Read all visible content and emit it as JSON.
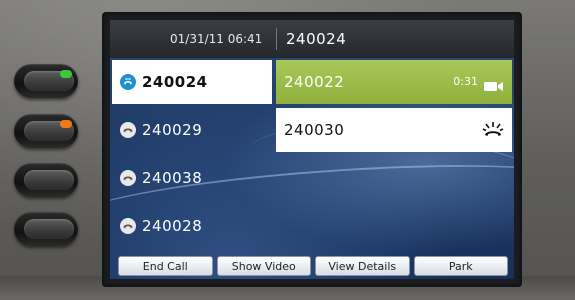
{
  "header": {
    "datetime": "01/31/11 06:41",
    "line_number": "240024"
  },
  "lines": [
    {
      "label": "240024",
      "state": "active",
      "icon": "phone-handset-active-icon"
    },
    {
      "label": "240029",
      "state": "idle",
      "icon": "phone-handset-icon"
    },
    {
      "label": "240038",
      "state": "idle",
      "icon": "phone-handset-icon"
    },
    {
      "label": "240028",
      "state": "idle",
      "icon": "phone-handset-icon"
    }
  ],
  "calls": [
    {
      "number": "240022",
      "duration": "0:31",
      "icon": "video-camera-icon",
      "color": "#9bbd4a"
    },
    {
      "number": "240030",
      "icon": "ringing-icon"
    }
  ],
  "softkeys": [
    "End Call",
    "Show Video",
    "View Details",
    "Park"
  ],
  "led_colors": {
    "line1": "#3cc83c",
    "line2": "#f07a1a"
  }
}
